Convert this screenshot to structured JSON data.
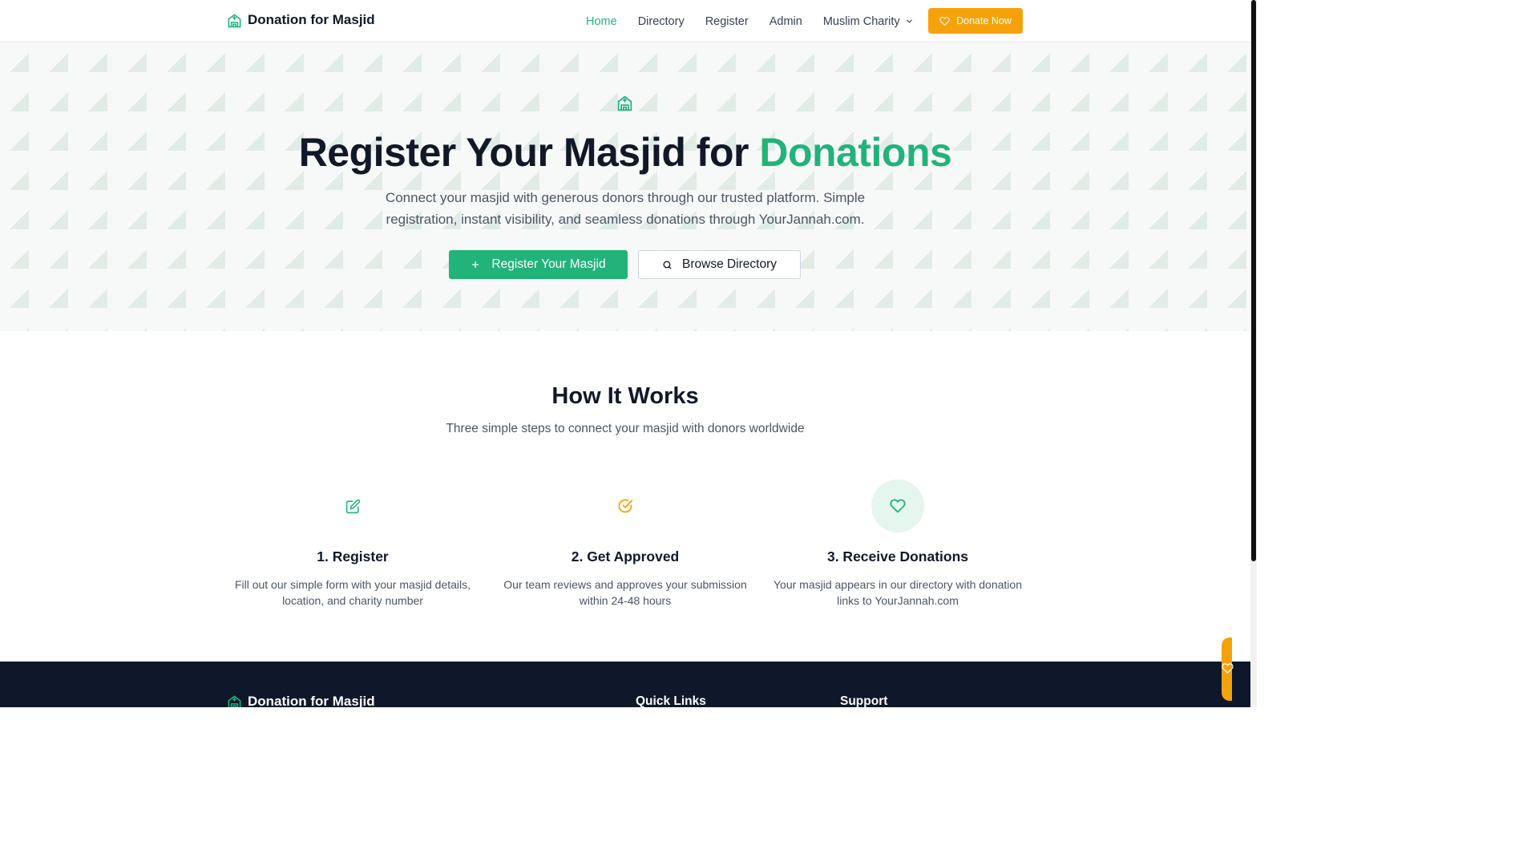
{
  "nav": {
    "brand": "Donation for Masjid",
    "links": [
      "Home",
      "Directory",
      "Register",
      "Admin"
    ],
    "dropdown_label": "Muslim Charity",
    "donate_label": "Donate Now",
    "brand_icon": "mosque-icon",
    "dropdown_icon": "chevron-down-icon",
    "donate_icon": "heart-icon"
  },
  "hero": {
    "icon": "mosque-icon",
    "title_main": "Register Your Masjid for ",
    "title_accent": "Donations",
    "subtitle": "Connect your masjid with generous donors through our trusted platform. Simple registration, instant visibility, and seamless donations through YourJannah.com.",
    "primary_button": "Register Your Masjid",
    "secondary_button": "Browse Directory",
    "primary_icon": "plus-icon",
    "secondary_icon": "search-icon"
  },
  "how": {
    "title": "How It Works",
    "subtitle": "Three simple steps to connect your masjid with donors worldwide",
    "steps": [
      {
        "title": "1. Register",
        "desc": "Fill out our simple form with your masjid details, location, and charity number",
        "icon": "edit-icon"
      },
      {
        "title": "2. Get Approved",
        "desc": "Our team reviews and approves your submission within 24-48 hours",
        "icon": "check-circle-icon"
      },
      {
        "title": "3. Receive Donations",
        "desc": "Your masjid appears in our directory with donation links to YourJannah.com",
        "icon": "heart-icon"
      }
    ]
  },
  "footer": {
    "brand": "Donation for Masjid",
    "quick_links": "Quick Links",
    "support": "Support"
  },
  "colors": {
    "brand_green": "#22b37a",
    "accent_orange": "#f5a20a",
    "dark": "#0f172a",
    "text": "#111827",
    "muted": "#4b5563"
  }
}
